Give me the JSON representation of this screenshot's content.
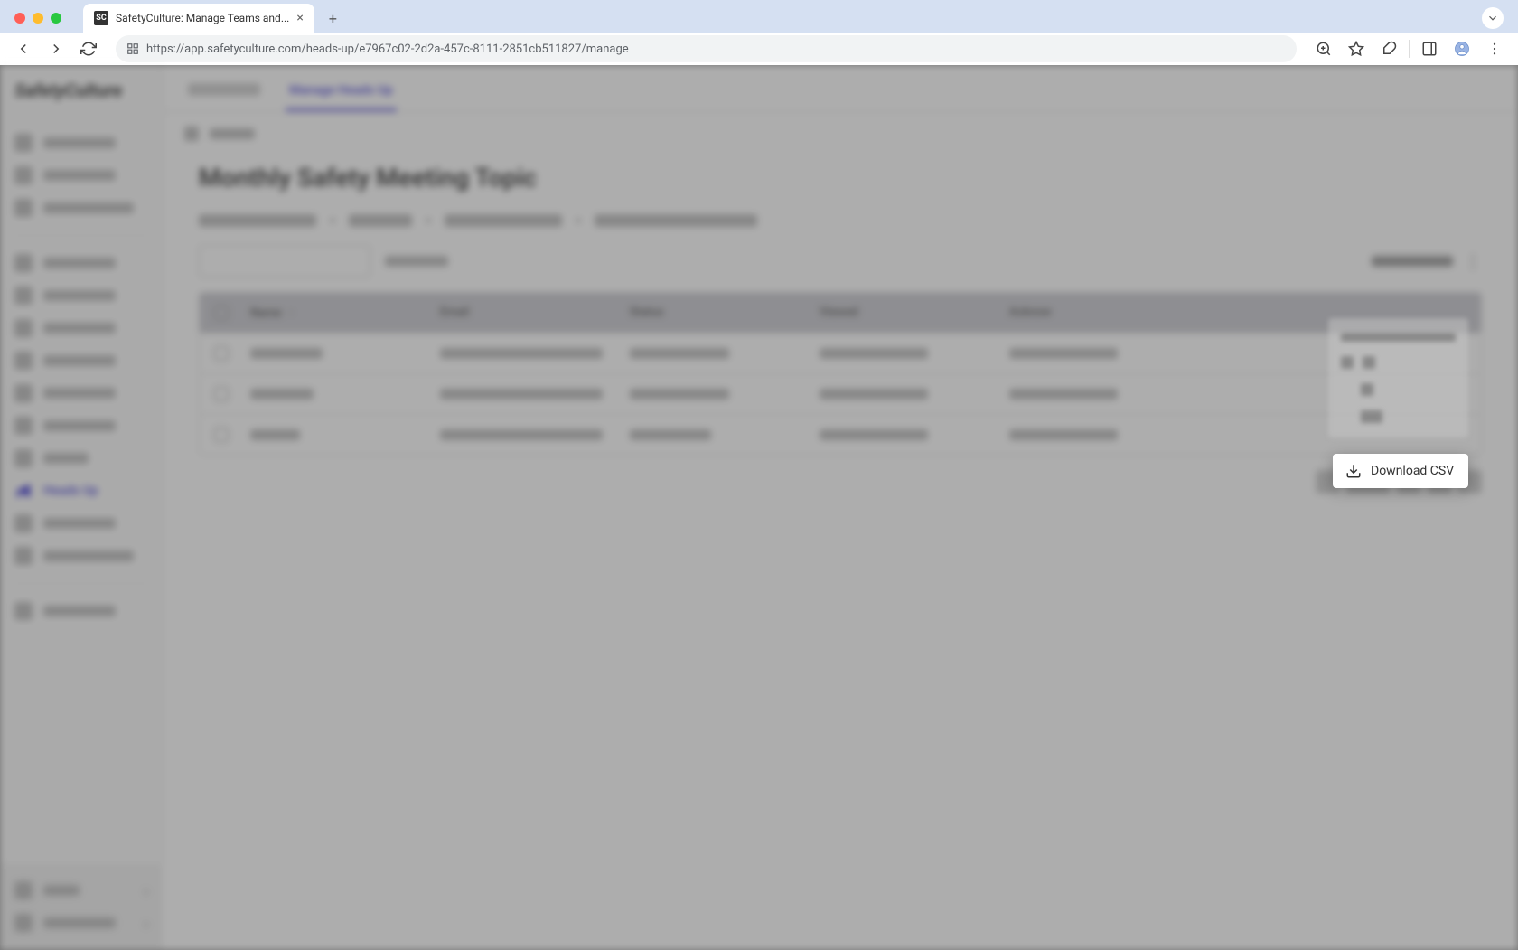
{
  "browser": {
    "tab_title": "SafetyCulture: Manage Teams and...",
    "url": "https://app.safetyculture.com/heads-up/e7967c02-2d2a-457c-8111-2851cb511827/manage"
  },
  "app": {
    "logo": "SafetyCulture",
    "sidebar": {
      "active_item": "Heads Up"
    },
    "tabs": {
      "active": "Manage Heads Up"
    },
    "page_title": "Monthly Safety Meeting Topic",
    "table": {
      "columns": {
        "name": "Name",
        "email": "Email",
        "status": "Status",
        "viewed": "Viewed",
        "acknowledged": "Acknow"
      }
    },
    "dropdown": {
      "download_csv": "Download CSV"
    }
  }
}
